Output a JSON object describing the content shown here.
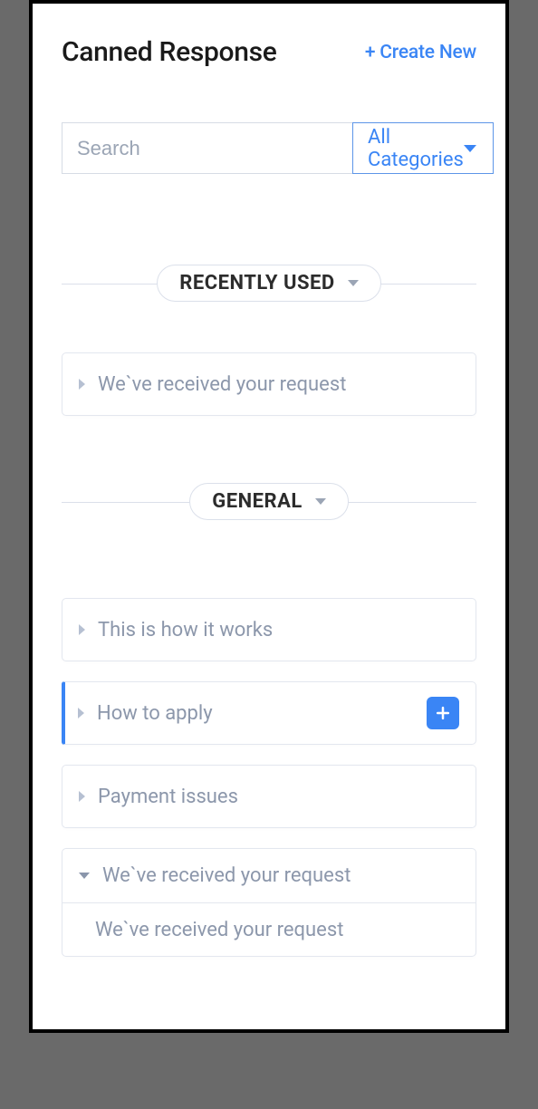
{
  "header": {
    "title": "Canned Response",
    "create_new": "+ Create New"
  },
  "search": {
    "placeholder": "Search",
    "value": ""
  },
  "category_select": {
    "label": "All Categories"
  },
  "sections": {
    "recently_used": {
      "label": "RECENTLY USED",
      "items": [
        {
          "label": "We`ve received your request"
        }
      ]
    },
    "general": {
      "label": "GENERAL",
      "items": [
        {
          "label": "This is how it works"
        },
        {
          "label": "How to apply"
        },
        {
          "label": "Payment issues"
        },
        {
          "label": "We`ve received your request",
          "sub": "We`ve received your request"
        }
      ]
    }
  }
}
